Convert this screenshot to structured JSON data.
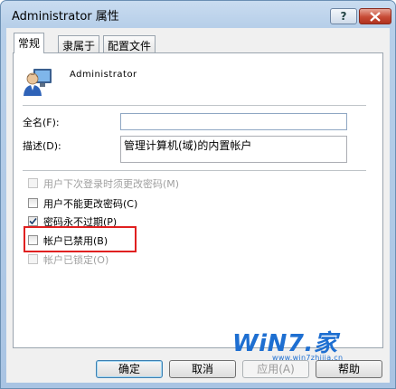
{
  "window": {
    "title": "Administrator 属性",
    "help_label": "?"
  },
  "tabs": [
    {
      "label": "常规",
      "active": true
    },
    {
      "label": "隶属于",
      "active": false
    },
    {
      "label": "配置文件",
      "active": false
    }
  ],
  "user": {
    "name": "Administrator",
    "icon": "user-monitor-icon"
  },
  "fields": {
    "fullname_label": "全名(F):",
    "fullname_value": "",
    "description_label": "描述(D):",
    "description_value": "管理计算机(域)的内置帐户"
  },
  "checkboxes": [
    {
      "label": "用户下次登录时须更改密码(M)",
      "checked": false,
      "disabled": true
    },
    {
      "label": "用户不能更改密码(C)",
      "checked": false,
      "disabled": false
    },
    {
      "label": "密码永不过期(P)",
      "checked": true,
      "disabled": false
    },
    {
      "label": "帐户已禁用(B)",
      "checked": false,
      "disabled": false
    },
    {
      "label": "帐户已锁定(O)",
      "checked": false,
      "disabled": true
    }
  ],
  "watermark": {
    "logo": "WiN7.家",
    "url": "www.win7zhijia.cn"
  },
  "buttons": {
    "ok": "确定",
    "cancel": "取消",
    "apply": "应用(A)",
    "help": "帮助"
  },
  "colors": {
    "highlight": "#e02020",
    "accent": "#1e6fd1"
  }
}
